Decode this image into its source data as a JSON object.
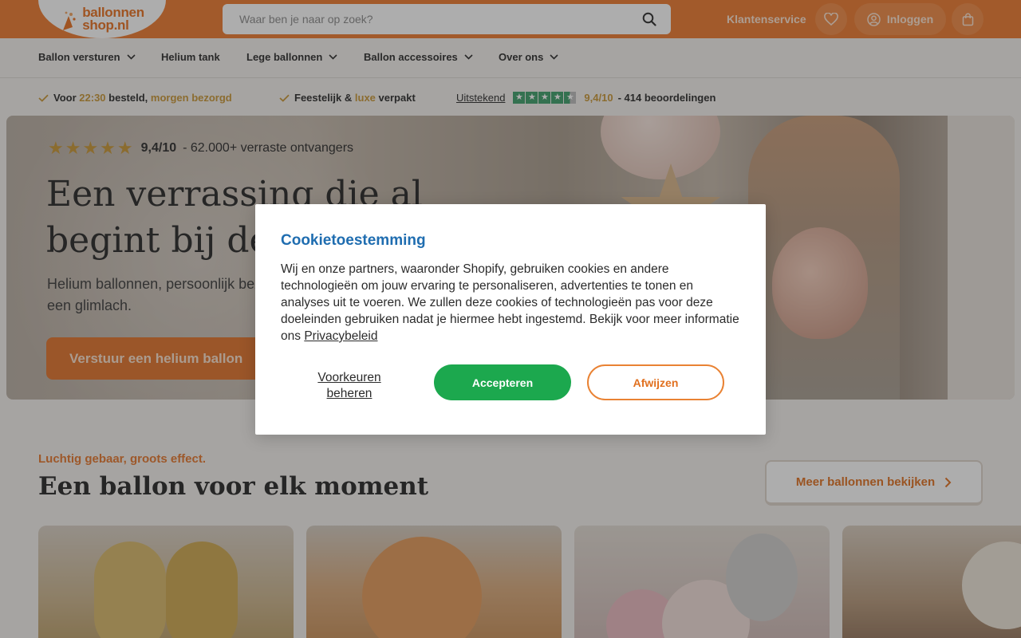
{
  "header": {
    "logo_line1": "ballonnen",
    "logo_line2": "shop.nl",
    "search_placeholder": "Waar ben je naar op zoek?",
    "customer_service": "Klantenservice",
    "login": "Inloggen"
  },
  "nav": {
    "items": [
      {
        "label": "Ballon versturen",
        "dropdown": true
      },
      {
        "label": "Helium tank",
        "dropdown": false
      },
      {
        "label": "Lege ballonnen",
        "dropdown": true
      },
      {
        "label": "Ballon accessoires",
        "dropdown": true
      },
      {
        "label": "Over ons",
        "dropdown": true
      }
    ]
  },
  "usps": {
    "u1_pre": "Voor",
    "u1_time": "22:30",
    "u1_mid": "besteld,",
    "u1_acc": "morgen bezorgd",
    "u2_pre": "Feestelijk &",
    "u2_acc": "luxe",
    "u2_post": "verpakt",
    "tp_label": "Uitstekend",
    "tp_score": "9,4/10",
    "tp_reviews": "- 414 beoordelingen"
  },
  "hero": {
    "stars": "★★★★★",
    "score": "9,4/10",
    "recipients": "- 62.000+ verraste ontvangers",
    "title": "Een verrassing die al begint bij de deur",
    "subtitle": "Helium ballonnen, persoonlijk bezorgd. Vandaag besteld, morgen een glimlach.",
    "cta": "Verstuur een helium ballon"
  },
  "section": {
    "kicker": "Luchtig gebaar, groots effect.",
    "title": "Een ballon voor elk moment",
    "more_button": "Meer ballonnen bekijken"
  },
  "cookie": {
    "title": "Cookietoestemming",
    "text": "Wij en onze partners, waaronder Shopify, gebruiken cookies en andere technologieën om jouw ervaring te personaliseren, advertenties te tonen en analyses uit te voeren. We zullen deze cookies of technologieën pas voor deze doeleinden gebruiken nadat je hiermee hebt ingestemd. Bekijk voor meer informatie ons",
    "policy_link": "Privacybeleid",
    "preferences": "Voorkeuren beheren",
    "accept": "Accepteren",
    "reject": "Afwijzen"
  },
  "colors": {
    "brand_orange": "#ee7a2e",
    "accept_green": "#1ca84e",
    "title_blue": "#1f6db0",
    "gold": "#c99635",
    "trustpilot_green": "#3d9e6a"
  },
  "icons": [
    "search-icon",
    "heart-icon",
    "user-icon",
    "shopping-bag-icon",
    "chevron-down-icon",
    "check-icon",
    "star-icon",
    "chevron-right-icon"
  ]
}
